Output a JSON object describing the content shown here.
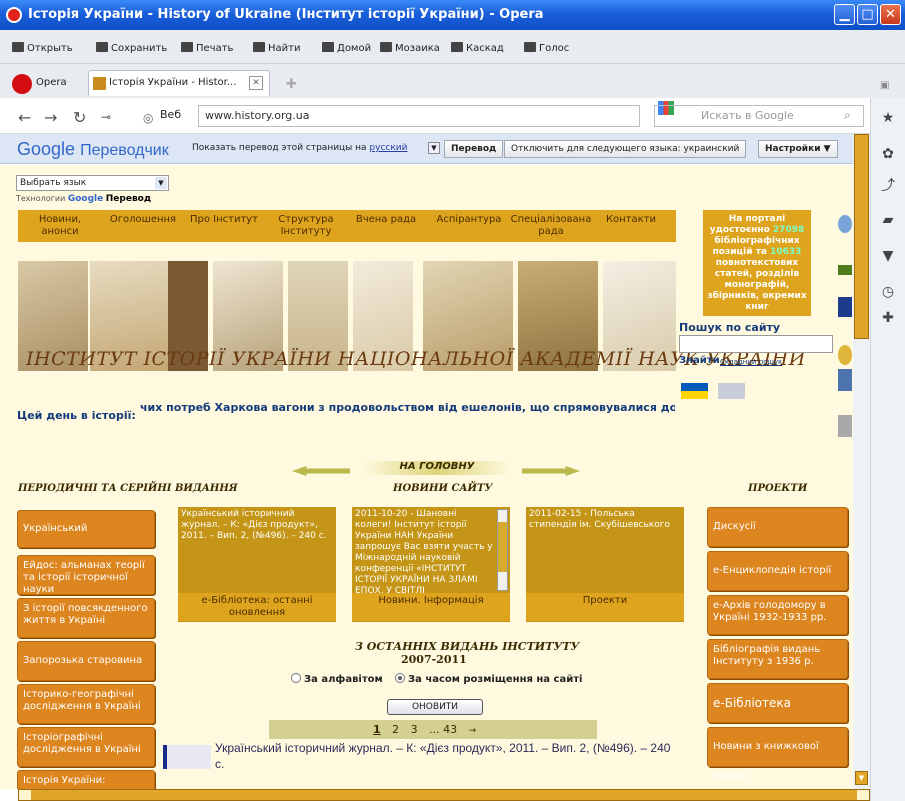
{
  "window": {
    "title": "Історія України - History of Ukraine (Інститут історії України) - Opera"
  },
  "menubar": {
    "items": [
      "Открыть",
      "Сохранить",
      "Печать",
      "Найти",
      "Домой",
      "Мозаика",
      "Каскад",
      "Голос"
    ]
  },
  "tabs": {
    "opera_label": "Opera",
    "active_tab": "Історія України - Histor..."
  },
  "navbar": {
    "web_label": "Веб",
    "url": "www.history.org.ua",
    "search_placeholder": "Искать в Google"
  },
  "translate_bar": {
    "logo_google": "Google",
    "logo_translate": "Переводчик",
    "prompt": "Показать перевод этой страницы на",
    "language": "русский",
    "translate_button": "Перевод",
    "disable_button": "Отключить для следующего языка: украинский",
    "settings_button": "Настройки ▼"
  },
  "translate_widget": {
    "select_label": "Выбрать язык",
    "powered_by": "Технологии",
    "powered_google": "Google",
    "powered_translate": "Перевод"
  },
  "top_nav": {
    "items": [
      "Новини, анонси",
      "Оголошення",
      "Про Інститут",
      "Структура Інституту",
      "Вчена рада",
      "Аспірантура",
      "Спеціалізована рада",
      "Контакти"
    ]
  },
  "portal_info": {
    "line1": "На порталі удостоєнно",
    "count1": "27098",
    "line2": "бібліографічних позицій та",
    "count2": "10633",
    "line3": "повнотекстових статей, розділів монографій, збірників, окремих книг"
  },
  "banner": {
    "title": "ІНСТИТУТ ІСТОРІЇ УКРАЇНИ НАЦІОНАЛЬНОЇ АКАДЕМІЇ НАУК УКРАЇНИ"
  },
  "site_search": {
    "heading": "Пошук по сайту",
    "submit": "Знайти",
    "advanced": "Складний пошук"
  },
  "today": {
    "label": "Цей день в історії:",
    "ticker": "чих потреб Харкова вагони з продовольством від ешелонів, що спрямовувалися до Моск"
  },
  "home_nav": {
    "label": "НА ГОЛОВНУ"
  },
  "sections": {
    "periodicals": "ПЕРІОДИЧНІ ТА СЕРІЙНІ ВИДАННЯ",
    "news": "НОВИНИ САЙТУ",
    "projects": "ПРОЕКТИ"
  },
  "left_menu": [
    "Український історичний журнал",
    "Ейдос: альманах теорії та історії історичної науки",
    "З історії повсякденного життя в Україні",
    "Запорозька старовина",
    "Історико-географічні дослідження в Україні",
    "Історіографічні дослідження в Україні",
    "Історія України:"
  ],
  "right_menu": [
    "Дискусії",
    "е-Енциклопедія історії України",
    "е-Архів голодомору в Україні 1932-1933 рр.",
    "Бібліографія видань Інституту з 1936 р.",
    "е-Бібліотека",
    "Новини з книжкової полиці"
  ],
  "news_boxes": [
    {
      "text": "Український історичний журнал. – К: «Дієз продукт», 2011. – Вип. 2, (№496). – 240 с.",
      "footer": "е-Бібліотека: останні оновлення"
    },
    {
      "text": "2011-10-20 - Шановні колеги! Інститут історії України НАН України запрошує Вас взяти участь у Міжнародній науковій конференції «ІНСТИТУТ ІСТОРІЇ УКРАЇНИ НА ЗЛАМІ ЕПОХ, У СВІТЛІ",
      "footer": "Новини. Інформація"
    },
    {
      "text": "2011-02-15 - Польська стипендія ім. Скубішевського",
      "footer": "Проекти"
    }
  ],
  "publications": {
    "heading": "З ОСТАННІХ ВИДАНЬ ІНСТИТУТУ",
    "years": "2007-2011",
    "sort_alpha": "За алфавітом",
    "sort_date": "За часом розміщення на сайті",
    "refresh": "ОНОВИТИ",
    "pages": [
      "1",
      "2",
      "3",
      "... 43",
      "→"
    ],
    "item": "Український історичний журнал. – К: «Дієз продукт», 2011. – Вип. 2, (№496). – 240 с."
  }
}
